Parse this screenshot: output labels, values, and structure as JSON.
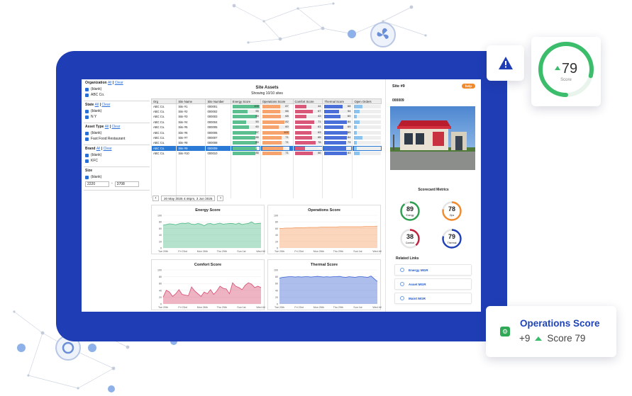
{
  "colors": {
    "frame": "#1f3db5",
    "energy": "#5bbf8f",
    "operations": "#f6a36d",
    "comfort": "#d9587a",
    "thermal": "#4a6fd8",
    "selected_row": "#2b7bd6",
    "help": "#f18a2c"
  },
  "filters": {
    "organization": {
      "title": "Organization",
      "all": "All",
      "clear": "Clear",
      "options": [
        "(blank)",
        "ABC Co."
      ]
    },
    "state": {
      "title": "State",
      "all": "All",
      "clear": "Clear",
      "options": [
        "(blank)",
        "N Y"
      ]
    },
    "asset_type": {
      "title": "Asset Type",
      "all": "All",
      "clear": "Clear",
      "options": [
        "(blank)",
        "Fast Food Restaurant"
      ]
    },
    "brand": {
      "title": "Brand",
      "all": "All",
      "clear": "Clear",
      "options": [
        "(blank)",
        "KFC"
      ]
    },
    "size": {
      "title": "Size",
      "options": [
        "(blank)"
      ],
      "min": "2220",
      "sep": "-",
      "max": "3708"
    }
  },
  "site_assets": {
    "title": "Site Assets",
    "subtitle": "Showing 10/10 sites",
    "columns": [
      "Org",
      "Site Name",
      "Site Number",
      "Energy Score",
      "Operations Score",
      "Comfort Score",
      "Thermal Score",
      "Open Orders"
    ],
    "rows": [
      {
        "org": "ABC Co.",
        "name": "Site #1",
        "num": "000001",
        "energy": 100,
        "ops": 67,
        "comfort": 44,
        "thermal": 68,
        "orders": 0.3
      },
      {
        "org": "ABC Co.",
        "name": "Site #2",
        "num": "000002",
        "energy": 55,
        "ops": 66,
        "comfort": 67,
        "thermal": 54,
        "orders": 0.2
      },
      {
        "org": "ABC Co.",
        "name": "Site #3",
        "num": "000003",
        "energy": 89,
        "ops": 68,
        "comfort": 43,
        "thermal": 60,
        "orders": 0.1
      },
      {
        "org": "ABC Co.",
        "name": "Site #4",
        "num": "000004",
        "energy": 50,
        "ops": 82,
        "comfort": 71,
        "thermal": 84,
        "orders": 0.2
      },
      {
        "org": "ABC Co.",
        "name": "Site #5",
        "num": "000005",
        "energy": 60,
        "ops": 60,
        "comfort": 61,
        "thermal": 69,
        "orders": 0.1
      },
      {
        "org": "ABC Co.",
        "name": "Site #6",
        "num": "000006",
        "energy": 87,
        "ops": 102,
        "comfort": 63,
        "thermal": 85,
        "orders": 0.1
      },
      {
        "org": "ABC Co.",
        "name": "Site #7",
        "num": "000007",
        "energy": 85,
        "ops": 71,
        "comfort": 65,
        "thermal": 84,
        "orders": 0.3
      },
      {
        "org": "ABC Co.",
        "name": "Site #8",
        "num": "000008",
        "energy": 89,
        "ops": 71,
        "comfort": 78,
        "thermal": 79,
        "orders": 0.1
      },
      {
        "org": "ABC Co.",
        "name": "Site #9",
        "num": "000009",
        "energy": 89,
        "ops": 78,
        "comfort": 38,
        "thermal": 79,
        "orders": 0.1
      },
      {
        "org": "ABC Co.",
        "name": "Site #10",
        "num": "000010",
        "energy": 85,
        "ops": 71,
        "comfort": 66,
        "thermal": 83,
        "orders": 0.2
      }
    ],
    "selected_index": 8
  },
  "date_range": {
    "prev": "‹",
    "label": "20 May 2025 4:46pm, 3 Jun 2025",
    "next": "›"
  },
  "chart_data": [
    {
      "type": "area",
      "title": "Energy Score",
      "x": [
        "Tue 20th",
        "Fri 23rd",
        "Mon 26th",
        "Thu 29th",
        "Sun 1st",
        "Wed 4th"
      ],
      "ylim": [
        0,
        100
      ],
      "yticks": [
        0,
        20,
        40,
        60,
        80,
        100
      ],
      "color": "#5bbf8f",
      "values": [
        70,
        72,
        74,
        73,
        71,
        74,
        76,
        75,
        77,
        73,
        72,
        75,
        73,
        68,
        74,
        75,
        72,
        74,
        76,
        73,
        74,
        75,
        75,
        73,
        76,
        72,
        74,
        75,
        80,
        74,
        75,
        76
      ]
    },
    {
      "type": "area",
      "title": "Operations Score",
      "x": [
        "Tue 20th",
        "Fri 23rd",
        "Mon 26th",
        "Thu 29th",
        "Sun 1st",
        "Wed 4th"
      ],
      "ylim": [
        0,
        100
      ],
      "yticks": [
        0,
        20,
        40,
        60,
        80,
        100
      ],
      "color": "#f6a36d",
      "values": [
        60,
        60,
        61,
        61,
        61,
        62,
        62,
        62,
        62,
        63,
        63,
        63,
        63,
        64,
        64,
        64,
        64,
        64,
        64,
        65,
        65,
        65,
        65,
        65,
        65,
        65,
        65,
        66,
        66,
        66,
        66,
        67
      ]
    },
    {
      "type": "area",
      "title": "Comfort Score",
      "x": [
        "Tue 20th",
        "Fri 23rd",
        "Mon 26th",
        "Thu 29th",
        "Sun 1st",
        "Wed 4th"
      ],
      "ylim": [
        0,
        100
      ],
      "yticks": [
        0,
        20,
        40,
        60,
        80,
        100
      ],
      "color": "#d9587a",
      "values": [
        20,
        40,
        35,
        22,
        30,
        42,
        28,
        26,
        24,
        50,
        38,
        30,
        22,
        35,
        30,
        42,
        28,
        38,
        52,
        46,
        44,
        30,
        62,
        52,
        48,
        42,
        55,
        62,
        58,
        48,
        52,
        48
      ]
    },
    {
      "type": "area",
      "title": "Thermal Score",
      "x": [
        "Tue 20th",
        "Fri 23rd",
        "Mon 26th",
        "Thu 29th",
        "Sun 1st",
        "Wed 4th"
      ],
      "ylim": [
        0,
        100
      ],
      "yticks": [
        0,
        20,
        40,
        60,
        80,
        100
      ],
      "color": "#4a6fd8",
      "values": [
        76,
        78,
        79,
        80,
        80,
        79,
        80,
        79,
        80,
        80,
        79,
        80,
        81,
        80,
        79,
        80,
        79,
        80,
        80,
        81,
        79,
        78,
        80,
        79,
        78,
        80,
        80,
        79,
        78,
        82,
        74,
        66
      ]
    }
  ],
  "detail": {
    "site_title": "Site #9",
    "help": "help",
    "site_number": "000009",
    "scorecard_title": "Scorecard Metrics",
    "metrics": [
      {
        "value": "89",
        "label": "Energy",
        "color": "#2e9e4f",
        "fraction": 0.89
      },
      {
        "value": "78",
        "label": "Ops",
        "color": "#f18a2c",
        "fraction": 0.78
      },
      {
        "value": "38",
        "label": "Comfort",
        "color": "#c0213d",
        "fraction": 0.38
      },
      {
        "value": "79",
        "label": "Thermal",
        "color": "#2040b8",
        "fraction": 0.79
      }
    ],
    "related_title": "Related Links",
    "links": [
      "Energy MGR",
      "Asset MGR",
      "Maint MGR"
    ]
  },
  "score_card": {
    "value": "79",
    "label": "Score",
    "fraction": 0.79
  },
  "ops_card": {
    "title": "Operations Score",
    "delta": "+9",
    "score_text": "Score 79"
  }
}
